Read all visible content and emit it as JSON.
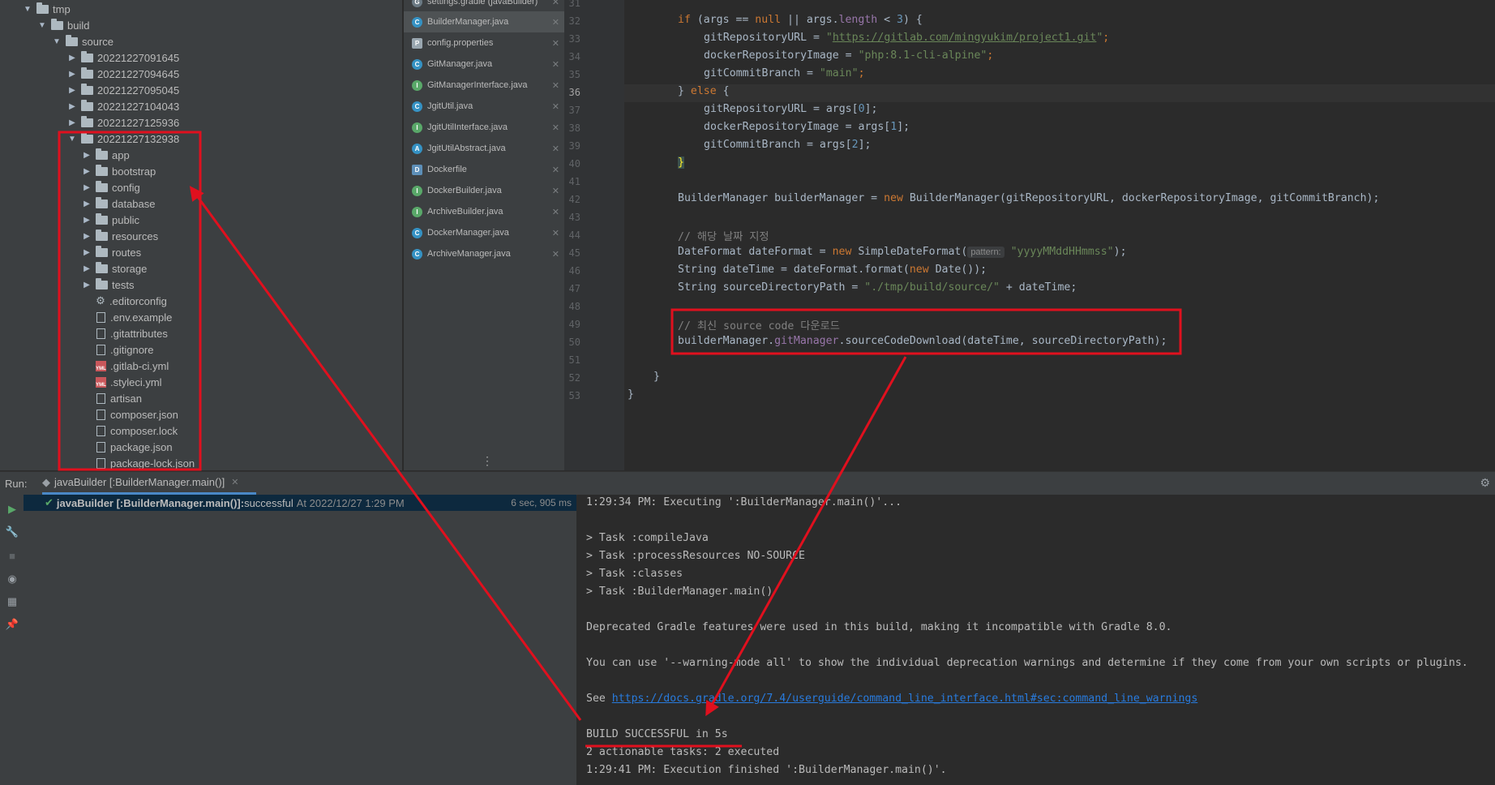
{
  "tree": {
    "items": [
      {
        "label": "tmp",
        "level": 0,
        "type": "folder",
        "expanded": true
      },
      {
        "label": "build",
        "level": 1,
        "type": "folder",
        "expanded": true
      },
      {
        "label": "source",
        "level": 2,
        "type": "folder",
        "expanded": true
      },
      {
        "label": "20221227091645",
        "level": 3,
        "type": "folder",
        "expanded": false
      },
      {
        "label": "20221227094645",
        "level": 3,
        "type": "folder",
        "expanded": false
      },
      {
        "label": "20221227095045",
        "level": 3,
        "type": "folder",
        "expanded": false
      },
      {
        "label": "20221227104043",
        "level": 3,
        "type": "folder",
        "expanded": false
      },
      {
        "label": "20221227125936",
        "level": 3,
        "type": "folder",
        "expanded": false
      },
      {
        "label": "20221227132938",
        "level": 3,
        "type": "folder",
        "expanded": true
      },
      {
        "label": "app",
        "level": 4,
        "type": "folder",
        "expanded": false
      },
      {
        "label": "bootstrap",
        "level": 4,
        "type": "folder",
        "expanded": false
      },
      {
        "label": "config",
        "level": 4,
        "type": "folder",
        "expanded": false
      },
      {
        "label": "database",
        "level": 4,
        "type": "folder",
        "expanded": false
      },
      {
        "label": "public",
        "level": 4,
        "type": "folder",
        "expanded": false
      },
      {
        "label": "resources",
        "level": 4,
        "type": "folder",
        "expanded": false
      },
      {
        "label": "routes",
        "level": 4,
        "type": "folder",
        "expanded": false
      },
      {
        "label": "storage",
        "level": 4,
        "type": "folder",
        "expanded": false
      },
      {
        "label": "tests",
        "level": 4,
        "type": "folder",
        "expanded": false
      },
      {
        "label": ".editorconfig",
        "level": 4,
        "type": "gear"
      },
      {
        "label": ".env.example",
        "level": 4,
        "type": "file"
      },
      {
        "label": ".gitattributes",
        "level": 4,
        "type": "file"
      },
      {
        "label": ".gitignore",
        "level": 4,
        "type": "file"
      },
      {
        "label": ".gitlab-ci.yml",
        "level": 4,
        "type": "yml"
      },
      {
        "label": ".styleci.yml",
        "level": 4,
        "type": "yml"
      },
      {
        "label": "artisan",
        "level": 4,
        "type": "file"
      },
      {
        "label": "composer.json",
        "level": 4,
        "type": "file"
      },
      {
        "label": "composer.lock",
        "level": 4,
        "type": "file"
      },
      {
        "label": "package.json",
        "level": 4,
        "type": "file"
      },
      {
        "label": "package-lock.json",
        "level": 4,
        "type": "file"
      }
    ]
  },
  "tabs": {
    "top_partial": "settings.gradle (javaBuilder)",
    "items": [
      {
        "label": "BuilderManager.java",
        "icon": "C",
        "color": "#3592c4",
        "active": true
      },
      {
        "label": "config.properties",
        "icon": "P",
        "color": "#9aa7b0",
        "active": false
      },
      {
        "label": "GitManager.java",
        "icon": "C",
        "color": "#3592c4",
        "active": false
      },
      {
        "label": "GitManagerInterface.java",
        "icon": "I",
        "color": "#59a869",
        "active": false
      },
      {
        "label": "JgitUtil.java",
        "icon": "C",
        "color": "#3592c4",
        "active": false
      },
      {
        "label": "JgitUtilInterface.java",
        "icon": "I",
        "color": "#59a869",
        "active": false
      },
      {
        "label": "JgitUtilAbstract.java",
        "icon": "A",
        "color": "#3592c4",
        "active": false
      },
      {
        "label": "Dockerfile",
        "icon": "D",
        "color": "#5d8fb8",
        "active": false
      },
      {
        "label": "DockerBuilder.java",
        "icon": "I",
        "color": "#59a869",
        "active": false
      },
      {
        "label": "ArchiveBuilder.java",
        "icon": "I",
        "color": "#59a869",
        "active": false
      },
      {
        "label": "DockerManager.java",
        "icon": "C",
        "color": "#3592c4",
        "active": false
      },
      {
        "label": "ArchiveManager.java",
        "icon": "C",
        "color": "#3592c4",
        "active": false
      }
    ],
    "more_icon": "vertical-dots-icon"
  },
  "editor": {
    "line_numbers": [
      "31",
      "32",
      "33",
      "34",
      "35",
      "36",
      "37",
      "38",
      "39",
      "40",
      "41",
      "42",
      "43",
      "44",
      "45",
      "46",
      "47",
      "48",
      "49",
      "50",
      "51",
      "52",
      "53"
    ],
    "current_line": "36",
    "code": {
      "l32_kw_if": "if",
      "l32_a": " (args == ",
      "l32_null": "null",
      "l32_b": " || args.",
      "l32_length": "length",
      "l32_c": " < ",
      "l32_num": "3",
      "l32_d": ") {",
      "l33_a": "gitRepositoryURL = ",
      "l33_url": "https://gitlab.com/mingyukim/project1.git",
      "l33_end": ";",
      "l34_a": "dockerRepositoryImage = ",
      "l34_str": "\"php:8.1-cli-alpine\"",
      "l34_end": ";",
      "l35_a": "gitCommitBranch = ",
      "l35_str": "\"main\"",
      "l35_end": ";",
      "l36_a": "} ",
      "l36_else": "else",
      "l36_b": " {",
      "l37_a": "gitRepositoryURL = args[",
      "l37_n": "0",
      "l37_b": "];",
      "l38_a": "dockerRepositoryImage = args[",
      "l38_n": "1",
      "l38_b": "];",
      "l39_a": "gitCommitBranch = args[",
      "l39_n": "2",
      "l39_b": "];",
      "l40": "}",
      "l42_a": "BuilderManager builderManager = ",
      "l42_new": "new",
      "l42_b": " BuilderManager(gitRepositoryURL, dockerRepositoryImage, gitCommitBranch);",
      "l44": "// 해당 날짜 지정",
      "l45_a": "DateFormat dateFormat = ",
      "l45_new": "new",
      "l45_b": " SimpleDateFormat(",
      "l45_hint": "pattern:",
      "l45_str": "\"yyyyMMddHHmmss\"",
      "l45_c": ");",
      "l46_a": "String dateTime = dateFormat.format(",
      "l46_new": "new",
      "l46_b": " Date());",
      "l47_a": "String sourceDirectoryPath = ",
      "l47_str": "\"./tmp/build/source/\"",
      "l47_b": " + dateTime;",
      "l49": "// 최신 source code 다운로드",
      "l50_a": "builderManager.",
      "l50_fld": "gitManager",
      "l50_b": ".sourceCodeDownload(dateTime, sourceDirectoryPath);",
      "l52": "}",
      "l53": "}"
    }
  },
  "run": {
    "label": "Run:",
    "tab": "javaBuilder [:BuilderManager.main()]",
    "tree_item_bold": "javaBuilder [:BuilderManager.main()]:",
    "tree_item_status": " successful",
    "tree_item_time": " At 2022/12/27 1:29 PM",
    "duration": "6 sec, 905 ms",
    "console": [
      "1:29:34 PM: Executing ':BuilderManager.main()'...",
      "",
      "> Task :compileJava",
      "> Task :processResources NO-SOURCE",
      "> Task :classes",
      "> Task :BuilderManager.main()",
      "",
      "Deprecated Gradle features were used in this build, making it incompatible with Gradle 8.0.",
      "",
      "You can use '--warning-mode all' to show the individual deprecation warnings and determine if they come from your own scripts or plugins.",
      "",
      "",
      "",
      "BUILD SUCCESSFUL in 5s",
      "2 actionable tasks: 2 executed",
      "1:29:41 PM: Execution finished ':BuilderManager.main()'."
    ],
    "see_prefix": "See ",
    "see_link": "https://docs.gradle.org/7.4/userguide/command_line_interface.html#sec:command_line_warnings"
  },
  "colors": {
    "annotation_red": "#e0101e",
    "success_green": "#59a869",
    "link_blue": "#287bde"
  }
}
